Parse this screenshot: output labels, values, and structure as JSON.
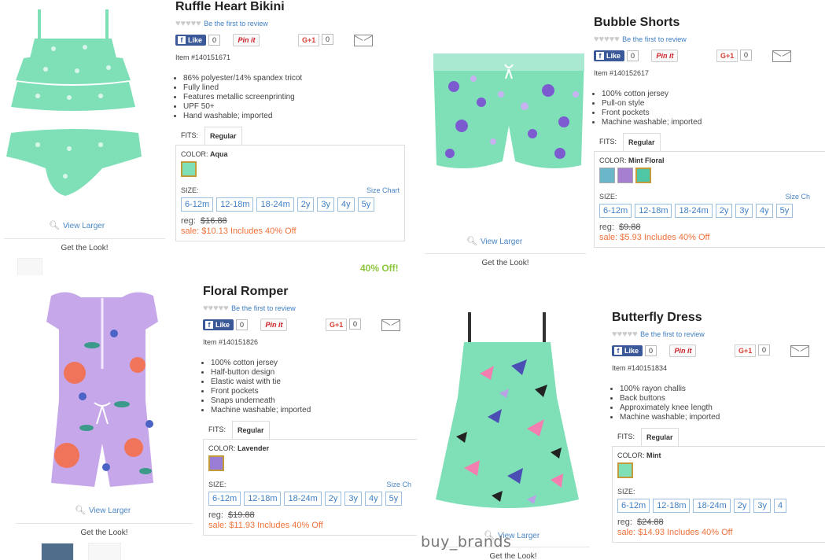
{
  "common": {
    "review_link": "Be the first to review",
    "like_label": "Like",
    "like_count": "0",
    "pin_label": "Pin it",
    "gplus_label": "G+1",
    "gplus_count": "0",
    "fits_label": "FITS:",
    "fit_tab": "Regular",
    "color_label": "COLOR:",
    "size_label": "SIZE:",
    "size_chart": "Size Chart",
    "size_chart_cut": "Size Ch",
    "reg_label": "reg:",
    "view_larger": "View Larger",
    "get_the_look": "Get the Look!",
    "icons": [
      "heart-icon",
      "facebook-icon",
      "pinterest-icon",
      "google-plus-icon",
      "mail-icon",
      "magnifier-icon"
    ]
  },
  "products": [
    {
      "title": "Ruffle Heart Bikini",
      "item": "Item #140151671",
      "features": [
        "86% polyester/14% spandex tricot",
        "Fully lined",
        "Features metallic screenprinting",
        "UPF 50+",
        "Hand washable; imported"
      ],
      "color": "Aqua",
      "swatches": [
        "#7fe0b8"
      ],
      "sizes": [
        "6-12m",
        "12-18m",
        "18-24m",
        "2y",
        "3y",
        "4y",
        "5y"
      ],
      "reg_price": "$16.88",
      "sale": "sale:  $10.13 Includes 40% Off",
      "badge": "40% Off!"
    },
    {
      "title": "Bubble Shorts",
      "item": "Item #140152617",
      "features": [
        "100% cotton jersey",
        "Pull-on style",
        "Front pockets",
        "Machine washable; imported"
      ],
      "color": "Mint Floral",
      "swatches": [
        "#6bb7c9",
        "#a77fd1",
        "#4fc6a4"
      ],
      "sizes": [
        "6-12m",
        "12-18m",
        "18-24m",
        "2y",
        "3y",
        "4y",
        "5y"
      ],
      "reg_price": "$9.88",
      "sale": "sale:  $5.93 Includes 40% Off"
    },
    {
      "title": "Floral Romper",
      "item": "Item #140151826",
      "features": [
        "100% cotton jersey",
        "Half-button design",
        "Elastic waist with tie",
        "Front pockets",
        "Snaps underneath",
        "Machine washable; imported"
      ],
      "color": "Lavender",
      "swatches": [
        "#9a7ed6"
      ],
      "sizes": [
        "6-12m",
        "12-18m",
        "18-24m",
        "2y",
        "3y",
        "4y",
        "5y"
      ],
      "reg_price": "$19.88",
      "sale": "sale:  $11.93 Includes 40% Off"
    },
    {
      "title": "Butterfly Dress",
      "item": "Item #140151834",
      "features": [
        "100% rayon challis",
        "Back buttons",
        "Approximately knee length",
        "Machine washable; imported"
      ],
      "color": "Mint",
      "swatches": [
        "#7fe0b8"
      ],
      "sizes": [
        "6-12m",
        "12-18m",
        "18-24m",
        "2y",
        "3y",
        "4"
      ],
      "reg_price": "$24.88",
      "sale": "sale:  $14.93 Includes 40% Off"
    }
  ],
  "watermark": "buy_brands",
  "colors": {
    "mint": "#7fe0b8",
    "lavender": "#c6a8ea",
    "link": "#3f7fc2",
    "sale": "#f0713a",
    "off_badge": "#8cc63e",
    "facebook": "#3b5998",
    "pinterest": "#cb2027"
  }
}
